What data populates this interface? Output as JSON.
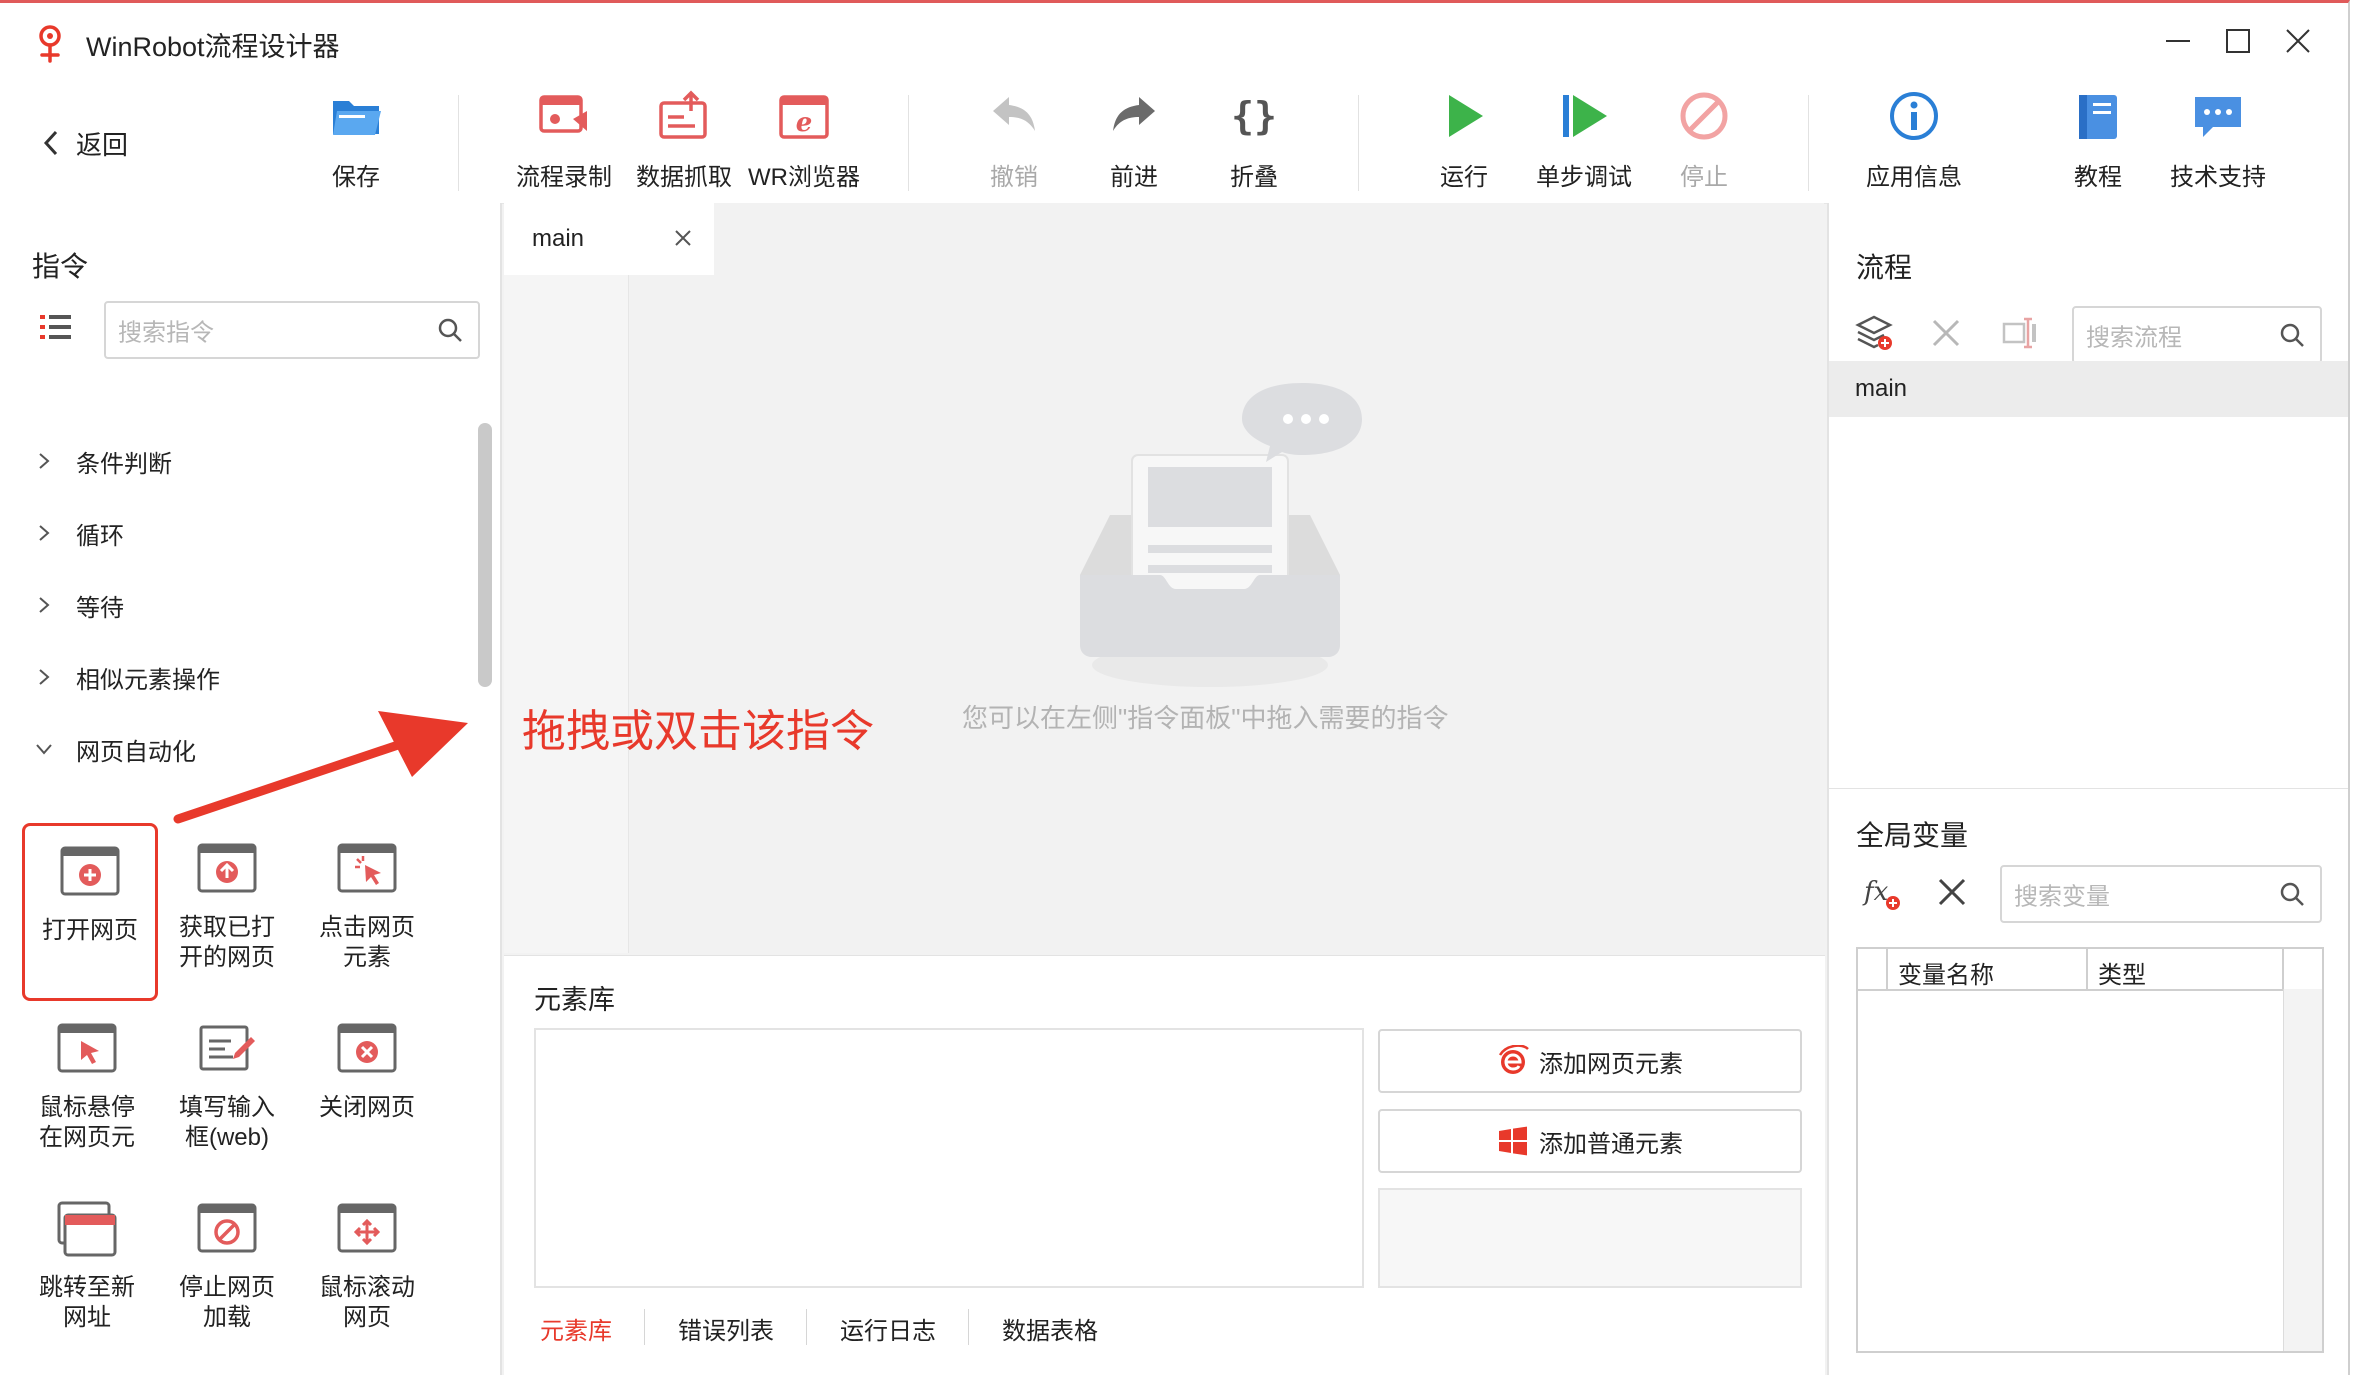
{
  "window": {
    "title": "WinRobot流程设计器",
    "accent_color": "#e8392b"
  },
  "toolbar": {
    "back_label": "返回",
    "save": "保存",
    "record": "流程录制",
    "scrape": "数据抓取",
    "browser": "WR浏览器",
    "undo": "撤销",
    "redo": "前进",
    "fold": "折叠",
    "run": "运行",
    "step_debug": "单步调试",
    "stop": "停止",
    "app_info": "应用信息",
    "tutorial": "教程",
    "support": "技术支持"
  },
  "commands_panel": {
    "title": "指令",
    "search_placeholder": "搜索指令",
    "categories": [
      "条件判断",
      "循环",
      "等待",
      "相似元素操作",
      "网页自动化"
    ],
    "items": [
      {
        "label": "打开网页",
        "icon": "open-webpage-icon",
        "selected": true
      },
      {
        "label": "获取已打开的网页",
        "icon": "get-opened-webpage-icon"
      },
      {
        "label": "点击网页元素",
        "icon": "click-web-element-icon"
      },
      {
        "label": "鼠标悬停在网页元",
        "icon": "mouse-hover-icon"
      },
      {
        "label": "填写输入框(web)",
        "icon": "fill-input-icon"
      },
      {
        "label": "关闭网页",
        "icon": "close-webpage-icon"
      },
      {
        "label": "跳转至新网址",
        "icon": "goto-url-icon"
      },
      {
        "label": "停止网页加载",
        "icon": "stop-loading-icon"
      },
      {
        "label": "鼠标滚动网页",
        "icon": "scroll-webpage-icon"
      }
    ]
  },
  "editor": {
    "tab_label": "main",
    "empty_hint": "您可以在左侧\"指令面板\"中拖入需要的指令",
    "annotation": "拖拽或双击该指令"
  },
  "element_library": {
    "title": "元素库",
    "add_web_element": "添加网页元素",
    "add_normal_element": "添加普通元素",
    "tabs": [
      "元素库",
      "错误列表",
      "运行日志",
      "数据表格"
    ],
    "active_tab": 0
  },
  "flow_panel": {
    "title": "流程",
    "search_placeholder": "搜索流程",
    "items": [
      "main"
    ]
  },
  "globals_panel": {
    "title": "全局变量",
    "search_placeholder": "搜索变量",
    "columns": [
      "变量名称",
      "类型"
    ]
  }
}
